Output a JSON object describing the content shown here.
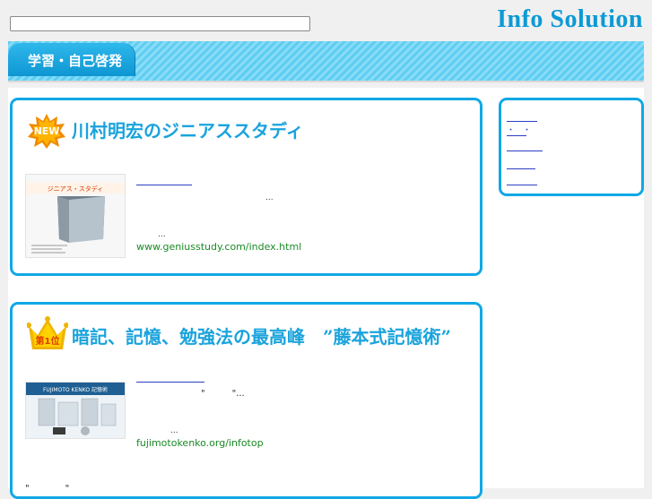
{
  "header": {
    "search_placeholder": "",
    "site_title": "Info Solution"
  },
  "category": {
    "tab_label": "学習・自己啓発"
  },
  "cards": [
    {
      "badge": "NEW",
      "title": "川村明宏のジニアススタディ",
      "ellipsis_1": "...",
      "ellipsis_2": "...",
      "url": "www.geniusstudy.com/index.html",
      "thumb_heading": "ジニアス・スタディ"
    },
    {
      "badge": "第1位",
      "title": "暗記、記憶、勉強法の最高峰　”藤本式記憶術”",
      "quote_line": "\"　　　\"...",
      "ellipsis_1": "...",
      "url": "fujimotokenko.org/infotop",
      "footer_quote": "\"　　　　\"",
      "thumb_heading": "FUJIMOTO KENKO 記憶術"
    }
  ],
  "sidebar": {
    "links": [
      {
        "label": ""
      },
      {
        "label": "・　・"
      },
      {
        "label": ""
      },
      {
        "label": ""
      },
      {
        "label": ""
      }
    ]
  },
  "colors": {
    "accent": "#10a8e6",
    "title": "#0b9ad6",
    "link": "#2a3fc2",
    "url": "#1a8a26"
  }
}
